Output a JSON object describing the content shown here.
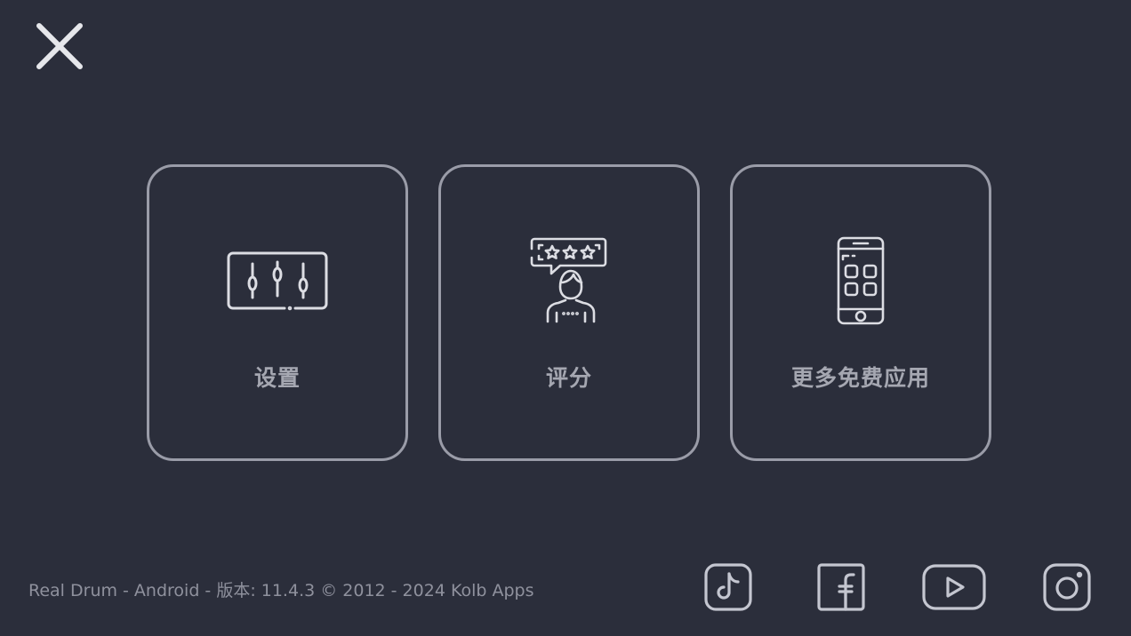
{
  "close": {
    "icon": "close-icon"
  },
  "menu": {
    "items": [
      {
        "label": "设置",
        "icon": "sliders-icon"
      },
      {
        "label": "评分",
        "icon": "rating-icon"
      },
      {
        "label": "更多免费应用",
        "icon": "phone-apps-icon"
      }
    ]
  },
  "footer": {
    "text": "Real Drum - Android - 版本: 11.4.3 © 2012 - 2024 Kolb Apps"
  },
  "social": {
    "items": [
      {
        "icon": "tiktok-icon"
      },
      {
        "icon": "facebook-icon"
      },
      {
        "icon": "youtube-icon"
      },
      {
        "icon": "instagram-icon"
      }
    ]
  },
  "colors": {
    "background": "#2b2e3b",
    "stroke": "#9a9ca8",
    "icon": "#dcdde3",
    "text": "#a5a7b1",
    "footer_text": "#8f919d"
  }
}
